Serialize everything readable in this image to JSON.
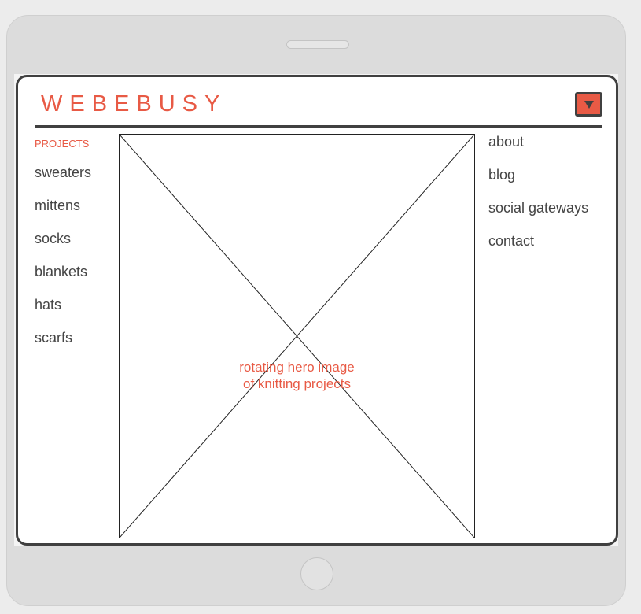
{
  "brand": {
    "logo_text": "WEBEBUSY"
  },
  "header": {
    "menu_icon": "caret-down-icon"
  },
  "left_nav": {
    "section_label": "PROJECTS",
    "items": [
      {
        "label": "sweaters"
      },
      {
        "label": "mittens"
      },
      {
        "label": "socks"
      },
      {
        "label": "blankets"
      },
      {
        "label": "hats"
      },
      {
        "label": "scarfs"
      }
    ]
  },
  "hero": {
    "caption": "rotating hero image\nof knitting projects",
    "placeholder_icon": "image-placeholder-x"
  },
  "right_nav": {
    "items": [
      {
        "label": "about"
      },
      {
        "label": "blog"
      },
      {
        "label": "social gateways"
      },
      {
        "label": "contact"
      }
    ]
  },
  "colors": {
    "accent": "#e85a45",
    "frame": "#404040",
    "text": "#444444",
    "device": "#dcdcdc"
  }
}
